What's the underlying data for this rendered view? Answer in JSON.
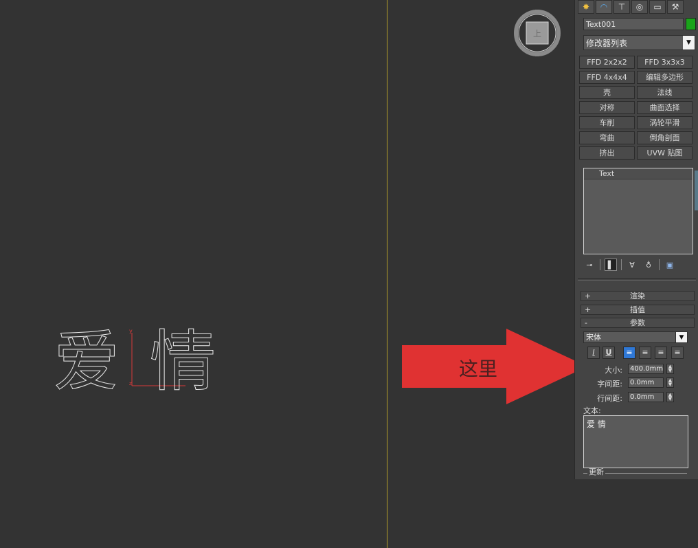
{
  "viewport": {
    "scene_text_chars": [
      "爱",
      "情"
    ],
    "annotation_label": "这里",
    "annotation_color": "#e03232"
  },
  "panel": {
    "tabs": [
      {
        "icon": "create-icon",
        "glyph": "✸"
      },
      {
        "icon": "modify-icon",
        "glyph": "◠"
      },
      {
        "icon": "hierarchy-icon",
        "glyph": "⊤"
      },
      {
        "icon": "motion-icon",
        "glyph": "◎"
      },
      {
        "icon": "display-icon",
        "glyph": "▭"
      },
      {
        "icon": "utilities-icon",
        "glyph": "⚒"
      }
    ],
    "object_name": "Text001",
    "object_color": "#1aa31a",
    "modifier_list": "修改器列表",
    "modifier_buttons": [
      "FFD 2x2x2",
      "FFD 3x3x3",
      "FFD 4x4x4",
      "编辑多边形",
      "壳",
      "法线",
      "对称",
      "曲面选择",
      "车削",
      "涡轮平滑",
      "弯曲",
      "倒角剖面",
      "挤出",
      "UVW 贴图"
    ],
    "stack_items": [
      "Text"
    ],
    "rollouts": {
      "render": {
        "sign": "+",
        "label": "渲染"
      },
      "interp": {
        "sign": "+",
        "label": "插值"
      },
      "params": {
        "sign": "-",
        "label": "参数"
      }
    },
    "font_name": "宋体",
    "format_buttons": [
      "I",
      "U",
      "≡",
      "≡",
      "≡",
      "≡"
    ],
    "size_label": "大小:",
    "size_value": "400.0mm",
    "kerning_label": "字间距:",
    "kerning_value": "0.0mm",
    "leading_label": "行间距:",
    "leading_value": "0.0mm",
    "text_label": "文本:",
    "text_value": "爱 情",
    "update_label": "更新"
  }
}
